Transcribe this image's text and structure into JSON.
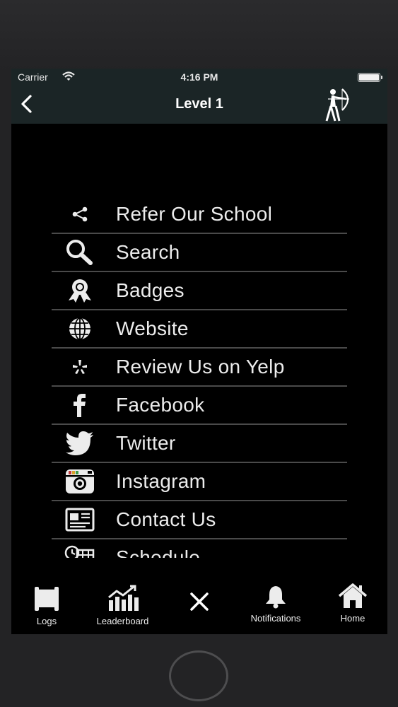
{
  "status_bar": {
    "carrier": "Carrier",
    "time": "4:16 PM"
  },
  "nav": {
    "title": "Level 1"
  },
  "menu": {
    "items": [
      {
        "label": "Refer Our School",
        "icon": "share-icon"
      },
      {
        "label": "Search",
        "icon": "search-icon"
      },
      {
        "label": "Badges",
        "icon": "badge-icon"
      },
      {
        "label": "Website",
        "icon": "globe-icon"
      },
      {
        "label": "Review Us on Yelp",
        "icon": "yelp-icon"
      },
      {
        "label": "Facebook",
        "icon": "facebook-icon"
      },
      {
        "label": "Twitter",
        "icon": "twitter-icon"
      },
      {
        "label": "Instagram",
        "icon": "instagram-icon"
      },
      {
        "label": "Contact Us",
        "icon": "contact-card-icon"
      },
      {
        "label": "Schedule",
        "icon": "schedule-icon"
      }
    ]
  },
  "tab_bar": {
    "logs": "Logs",
    "leaderboard": "Leaderboard",
    "notifications": "Notifications",
    "home": "Home"
  },
  "colors": {
    "bar_background": "#1b2526",
    "screen_background": "#000000",
    "divider": "#4a4a4a",
    "text": "#ececec"
  }
}
